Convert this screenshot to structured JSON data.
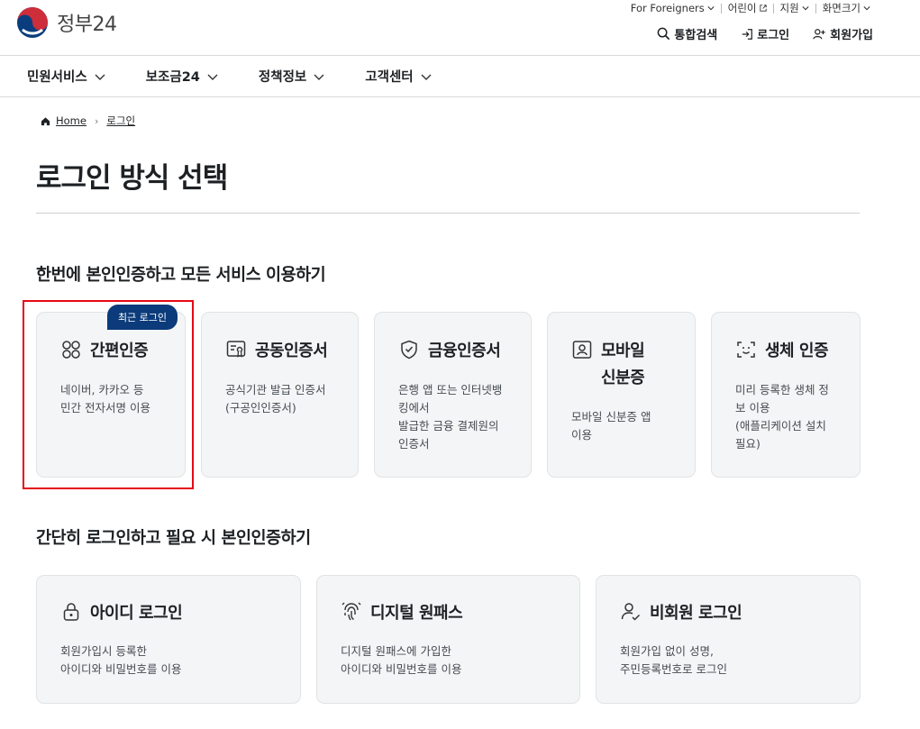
{
  "header": {
    "logo_text": "정부24",
    "util_links": [
      {
        "label": "For Foreigners",
        "icon": "chevron-down-icon"
      },
      {
        "label": "어린이",
        "icon": "external-link-icon"
      },
      {
        "label": "지원",
        "icon": "chevron-down-icon"
      },
      {
        "label": "화면크기",
        "icon": "chevron-down-icon"
      }
    ],
    "actions": {
      "search": "통합검색",
      "login": "로그인",
      "signup": "회원가입"
    }
  },
  "gnb": {
    "items": [
      "민원서비스",
      "보조금24",
      "정책정보",
      "고객센터"
    ]
  },
  "breadcrumb": {
    "home": "Home",
    "current": "로그인"
  },
  "page_title": "로그인 방식 선택",
  "section1": {
    "title": "한번에 본인인증하고 모든 서비스 이용하기",
    "badge": "최근 로그인",
    "cards": [
      {
        "title": "간편인증",
        "icon": "link-chain-icon",
        "desc": [
          "네이버, 카카오 등",
          "민간 전자서명 이용"
        ]
      },
      {
        "title": "공동인증서",
        "icon": "certificate-icon",
        "desc": [
          "공식기관 발급 인증서",
          "(구공인인증서)"
        ]
      },
      {
        "title": "금융인증서",
        "icon": "shield-check-icon",
        "desc": [
          "은행 앱 또는 인터넷뱅",
          "킹에서",
          "발급한 금융 결제원의",
          "인증서"
        ]
      },
      {
        "title_lines": [
          "모바일",
          "신분증"
        ],
        "icon": "id-card-icon",
        "desc": [
          "모바일 신분증 앱",
          "이용"
        ]
      },
      {
        "title": "생체 인증",
        "icon": "face-scan-icon",
        "desc": [
          "미리 등록한 생체 정",
          "보 이용",
          "(애플리케이션 설치",
          "필요)"
        ]
      }
    ]
  },
  "section2": {
    "title": "간단히 로그인하고 필요 시 본인인증하기",
    "cards": [
      {
        "title": "아이디 로그인",
        "icon": "lock-icon",
        "desc": [
          "회원가입시 등록한",
          "아이디와 비밀번호를 이용"
        ]
      },
      {
        "title": "디지털 원패스",
        "icon": "fingerprint-icon",
        "desc": [
          "디지털 원패스에 가입한",
          "아이디와 비밀번호를 이용"
        ]
      },
      {
        "title": "비회원 로그인",
        "icon": "user-check-icon",
        "desc": [
          "회원가입 없이 성명,",
          "주민등록번호로 로그인"
        ]
      }
    ]
  },
  "colors": {
    "badge": "#0b3b7a",
    "highlight": "#e50914",
    "card_bg": "#f4f5f6"
  }
}
